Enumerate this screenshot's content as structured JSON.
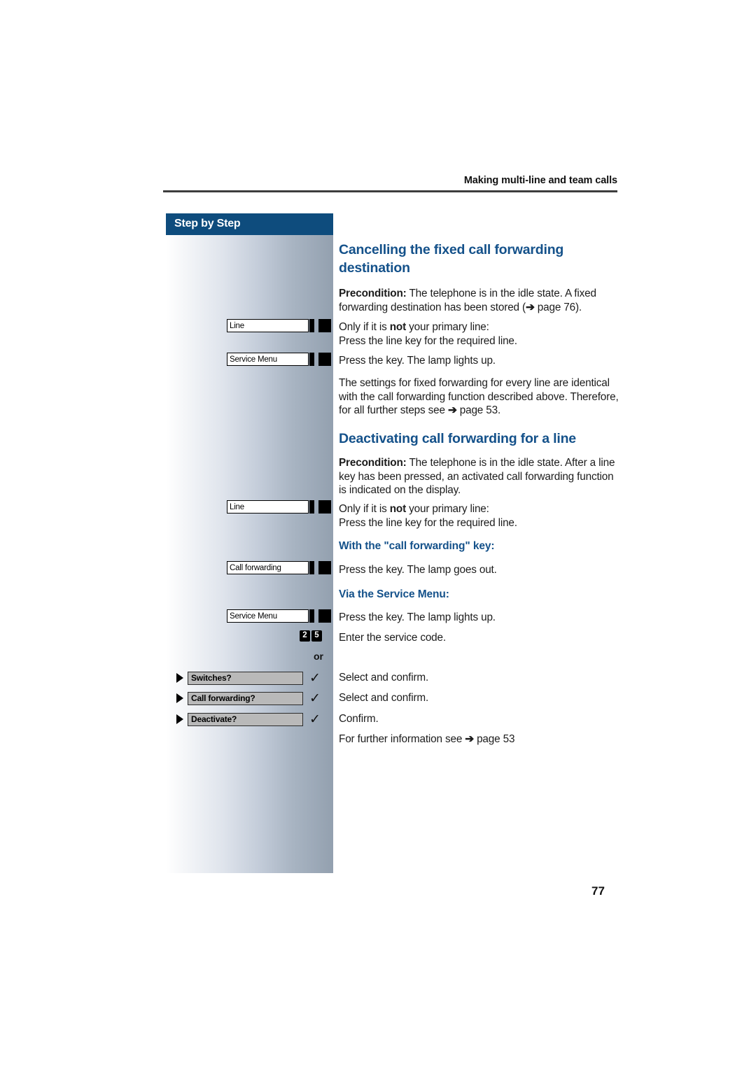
{
  "header": {
    "running_title": "Making multi-line and team calls"
  },
  "sidebar": {
    "title": "Step by Step",
    "keys": [
      {
        "label": "Line",
        "name": "line-key"
      },
      {
        "label": "Service Menu",
        "name": "service-menu-key"
      },
      {
        "label": "Line",
        "name": "line-key"
      },
      {
        "label": "Call forwarding",
        "name": "call-forwarding-key"
      },
      {
        "label": "Service Menu",
        "name": "service-menu-key"
      }
    ],
    "digit_keys": [
      "2",
      "5"
    ],
    "or_label": "or",
    "menu_options": [
      {
        "label": "Switches?",
        "check": "✓"
      },
      {
        "label": "Call forwarding?",
        "check": "✓"
      },
      {
        "label": "Deactivate?",
        "check": "✓"
      }
    ]
  },
  "content": {
    "heading1": "Cancelling the fixed call forwarding destination",
    "precondition_label_1": "Precondition:",
    "precondition_text_1": " The telephone is in the idle state. A fixed forwarding destination has been stored (",
    "precondition_arrow_1": "➔",
    "precondition_ref_1": " page 76).",
    "only_if_prefix": "Only if it is ",
    "only_if_bold": "not",
    "only_if_suffix": " your primary line:",
    "press_line_key": "Press the line key for the required line.",
    "press_lamp_up_1": "Press the key. The lamp lights up.",
    "settings_para": "The settings for fixed forwarding for every line are identical with the call forwarding function described above. Therefore, for all further steps see ",
    "settings_arrow": "➔",
    "settings_ref": " page 53.",
    "heading2": "Deactivating call forwarding for a line",
    "precondition_label_2": "Precondition:",
    "precondition_text_2": " The telephone is in the idle state. After a line key has been pressed, an activated call forwarding function is indicated on the display.",
    "only_if_prefix_2": "Only if it is ",
    "only_if_bold_2": "not",
    "only_if_suffix_2": " your primary line:",
    "press_line_key_2": "Press the line key for the required line.",
    "subheading_cf_key": "With the \"call forwarding\" key:",
    "press_lamp_out": "Press the key. The lamp goes out.",
    "subheading_service_menu": "Via the Service Menu:",
    "press_lamp_up_2": "Press the key. The lamp lights up.",
    "enter_service_code": "Enter the service code.",
    "select_confirm_1": "Select and confirm.",
    "select_confirm_2": "Select and confirm.",
    "confirm": "Confirm.",
    "further_info_text": "For further information see ",
    "further_info_arrow": "➔",
    "further_info_ref": " page 53"
  },
  "footer": {
    "page_number": "77"
  }
}
